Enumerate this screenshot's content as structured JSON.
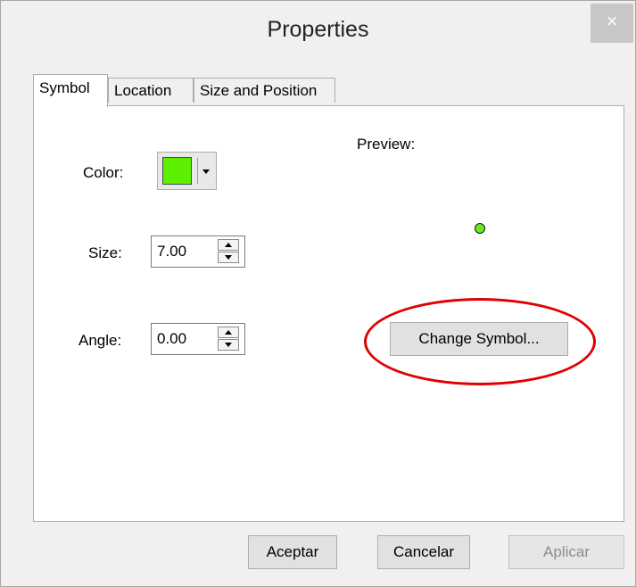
{
  "window": {
    "title": "Properties",
    "close_glyph": "×"
  },
  "tabs": [
    "Symbol",
    "Location",
    "Size and Position"
  ],
  "symbol": {
    "color_label": "Color:",
    "color_value": "#5cf000",
    "size_label": "Size:",
    "size_value": "7.00",
    "angle_label": "Angle:",
    "angle_value": "0.00",
    "preview_label": "Preview:",
    "preview_color": "#6be82a",
    "change_symbol_label": "Change Symbol..."
  },
  "footer": {
    "ok_label": "Aceptar",
    "cancel_label": "Cancelar",
    "apply_label": "Aplicar"
  },
  "annotation": {
    "highlight_color": "#e00000"
  }
}
